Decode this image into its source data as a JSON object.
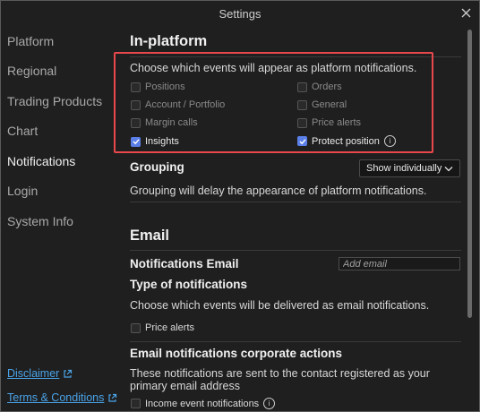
{
  "window": {
    "title": "Settings"
  },
  "sidebar": {
    "items": [
      {
        "label": "Platform"
      },
      {
        "label": "Regional"
      },
      {
        "label": "Trading Products"
      },
      {
        "label": "Chart"
      },
      {
        "label": "Notifications"
      },
      {
        "label": "Login"
      },
      {
        "label": "System Info"
      }
    ],
    "active": "Notifications",
    "disclaimer": "Disclaimer",
    "terms": "Terms & Conditions"
  },
  "inplatform": {
    "title": "In-platform",
    "description": "Choose which events will appear as platform notifications.",
    "checkboxes": [
      {
        "label": "Positions",
        "checked": false
      },
      {
        "label": "Orders",
        "checked": false
      },
      {
        "label": "Account / Portfolio",
        "checked": false
      },
      {
        "label": "General",
        "checked": false
      },
      {
        "label": "Margin calls",
        "checked": false
      },
      {
        "label": "Price alerts",
        "checked": false
      },
      {
        "label": "Insights",
        "checked": true
      },
      {
        "label": "Protect position",
        "checked": true
      }
    ]
  },
  "grouping": {
    "title": "Grouping",
    "dropdown_value": "Show individually",
    "description": "Grouping will delay the appearance of platform notifications."
  },
  "email": {
    "title": "Email",
    "notifications_email_label": "Notifications Email",
    "notifications_email_placeholder": "Add email",
    "type_title": "Type of notifications",
    "type_description": "Choose which events will be delivered as email notifications.",
    "price_alerts_label": "Price alerts",
    "price_alerts_checked": false,
    "corporate_title": "Email notifications corporate actions",
    "corporate_description": "These notifications are sent to the contact registered as your primary email address",
    "income_label": "Income event notifications"
  },
  "colors": {
    "accent": "#5b7fe8",
    "link": "#4aa3e8",
    "highlight": "#e8474b"
  }
}
